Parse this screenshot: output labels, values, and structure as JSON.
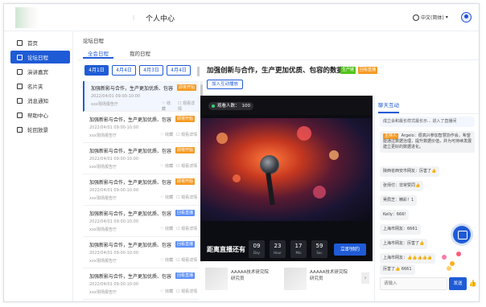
{
  "header": {
    "title": "个人中心",
    "separator": "|",
    "language": "中文(简体)"
  },
  "sidebar": {
    "items": [
      {
        "label": "首页",
        "icon": "home-icon",
        "active": false
      },
      {
        "label": "论坛日程",
        "icon": "calendar-icon",
        "active": true
      },
      {
        "label": "演讲嘉宾",
        "icon": "user-icon",
        "active": false
      },
      {
        "label": "名片夹",
        "icon": "card-icon",
        "active": false
      },
      {
        "label": "消息通知",
        "icon": "bell-icon",
        "active": false
      },
      {
        "label": "帮助中心",
        "icon": "help-icon",
        "active": false
      },
      {
        "label": "轮回放景",
        "icon": "replay-icon",
        "active": false
      }
    ]
  },
  "breadcrumb": "论坛日程",
  "main_tabs": [
    {
      "label": "全会日程",
      "active": true
    },
    {
      "label": "我的日程",
      "active": false
    }
  ],
  "date_tabs": [
    {
      "label": "4月1日",
      "active": true
    },
    {
      "label": "4月4日",
      "active": false
    },
    {
      "label": "4月3日",
      "active": false
    },
    {
      "label": "4月4日",
      "active": false
    }
  ],
  "schedule": [
    {
      "title": "加强新影与合作，生产更加优质、包容",
      "badge": "即将开始",
      "badge_color": "#f59a23",
      "time": "2022/04/01 09:00-10:00",
      "place": "xxx現场报告厅",
      "collect": "♡ 收藏",
      "share": "☐ 观看详情"
    },
    {
      "title": "加强新影与合作，生产更加优质、包容",
      "badge": "即将开始",
      "badge_color": "#f59a23",
      "time": "2022/04/01 09:00-10:00",
      "place": "xxx現场报告厅",
      "collect": "♡ 收藏",
      "share": "☐ 观看详情"
    },
    {
      "title": "加强新影与合作，生产更加优质、包容",
      "badge": "即将开始",
      "badge_color": "#f59a23",
      "time": "2022/04/01 09:00-10:00",
      "place": "xxx現场报告厅",
      "collect": "♡ 收藏",
      "share": "☐ 观看详情"
    },
    {
      "title": "加强新影与合作，生产更加优质、包容",
      "badge": "即将开始",
      "badge_color": "#f59a23",
      "time": "2022/04/01 09:00-10:00",
      "place": "xxx現场报告厅",
      "collect": "♡ 收藏",
      "share": "☐ 观看详情"
    },
    {
      "title": "加强新影与合作，生产更加优质、包容",
      "badge": "回看直播",
      "badge_color": "#5b8ff9",
      "time": "2022/04/01 09:00-10:00",
      "place": "xxx現场报告厅",
      "collect": "♡ 收藏",
      "share": "☐ 观看详情"
    },
    {
      "title": "加强新影与合作，生产更加优质、包容",
      "badge": "回看直播",
      "badge_color": "#5b8ff9",
      "time": "2022/04/01 09:00-10:00",
      "place": "xxx現场报告厅",
      "collect": "♡ 收藏",
      "share": "☐ 观看详情"
    },
    {
      "title": "加强新影与合作，生产更加优质、包容",
      "badge": "回看直播",
      "badge_color": "#5b8ff9",
      "time": "2022/04/01 09:00-10:00",
      "place": "xxx現场报告厅",
      "collect": "♡ 收藏",
      "share": "☐ 观看详情"
    }
  ],
  "event": {
    "title": "加强创新与合作，生产更加优质、包容的数据",
    "tag1": "生产链",
    "tag1_color": "#52c41a",
    "tag2": "回看直播",
    "tag2_color": "#f59a23",
    "join_label": "加入互动播放"
  },
  "video": {
    "viewers_label": "观看人数：",
    "viewers_count": "100",
    "countdown_label": "距离直播还有",
    "countdown": [
      {
        "num": "09",
        "unit": "Day"
      },
      {
        "num": "23",
        "unit": "Hour"
      },
      {
        "num": "17",
        "unit": "Min"
      },
      {
        "num": "59",
        "unit": "Sec"
      }
    ],
    "book_label": "立即预约"
  },
  "orgs": [
    {
      "name": "AAAAA技术研究院",
      "sub": "研究员"
    },
    {
      "name": "AAAAA技术研究院",
      "sub": "研究员"
    }
  ],
  "chat": {
    "title": "聊天互动",
    "messages": [
      {
        "text": "成立会和最长样式最长示... 进入了直播间",
        "notice": true
      },
      {
        "text": "Argelo：很高兴参加智慧协作会，希望能通过数据治理，提升数据价值，并为可持续发展建立更好的数据进化。",
        "tag": "主持人"
      },
      {
        "text": "陕西省西安市网友：厉害了👍"
      },
      {
        "text": "张师付：非常赞同👍"
      },
      {
        "text": "吴局芝：精彩！1"
      },
      {
        "text": "Kelly：666!"
      },
      {
        "text": "上海市网友：6661"
      },
      {
        "text": "上海市网友：厉害了👍"
      },
      {
        "text": "上海市网友：👍👍👍👍👍"
      },
      {
        "text": "厉害了👍   6661"
      }
    ],
    "input_placeholder": "请输入",
    "send_label": "发送",
    "like_label": "👍"
  },
  "colors": {
    "primary": "#1f5bd6",
    "orange": "#f59a23",
    "green": "#52c41a"
  }
}
